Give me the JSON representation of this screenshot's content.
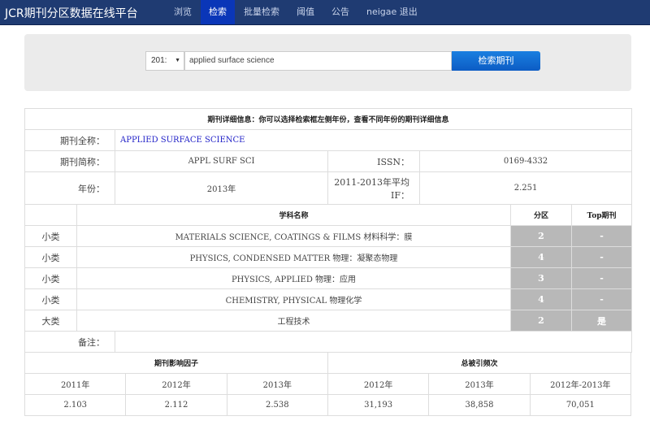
{
  "nav": {
    "brand": "JCR期刊分区数据在线平台",
    "items": [
      "浏览",
      "检索",
      "批量检索",
      "阈值",
      "公告",
      "neigae 退出"
    ],
    "active": 1
  },
  "search": {
    "year": "201:",
    "query": "applied surface science",
    "button": "检索期刊"
  },
  "detail": {
    "title": "期刊详细信息：你可以选择检索框左侧年份，查看不同年份的期刊详细信息",
    "full_name_label": "期刊全称：",
    "full_name": "APPLIED SURFACE SCIENCE",
    "abbr_label": "期刊简称：",
    "abbr": "APPL SURF SCI",
    "issn_label": "ISSN：",
    "issn": "0169-4332",
    "year_label": "年份：",
    "year": "2013年",
    "avg_if_label": "2011-2013年平均IF：",
    "avg_if": "2.251",
    "headers": {
      "subject": "学科名称",
      "zone": "分区",
      "top": "Top期刊"
    },
    "subjects": [
      {
        "type": "小类",
        "name": "MATERIALS SCIENCE, COATINGS & FILMS 材料科学：膜",
        "zone": "2",
        "top": "-"
      },
      {
        "type": "小类",
        "name": "PHYSICS, CONDENSED MATTER 物理：凝聚态物理",
        "zone": "4",
        "top": "-"
      },
      {
        "type": "小类",
        "name": "PHYSICS, APPLIED 物理：应用",
        "zone": "3",
        "top": "-"
      },
      {
        "type": "小类",
        "name": "CHEMISTRY, PHYSICAL 物理化学",
        "zone": "4",
        "top": "-"
      },
      {
        "type": "大类",
        "name": "工程技术",
        "zone": "2",
        "top": "是"
      }
    ],
    "note_label": "备注：",
    "note": ""
  },
  "stats": {
    "if_header": "期刊影响因子",
    "cite_header": "总被引频次",
    "cols": [
      "2011年",
      "2012年",
      "2013年",
      "2012年",
      "2013年",
      "2012年-2013年"
    ],
    "values": [
      "2.103",
      "2.112",
      "2.538",
      "31,193",
      "38,858",
      "70,051"
    ]
  }
}
